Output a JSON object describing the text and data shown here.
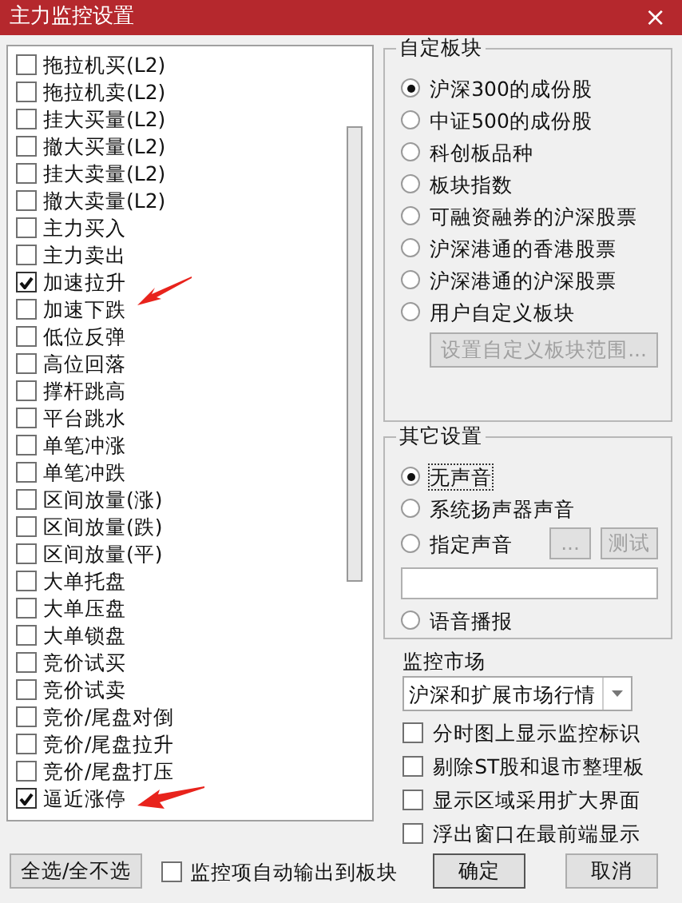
{
  "window": {
    "title": "主力监控设置",
    "close": "×"
  },
  "monitor_items": [
    {
      "label": "拖拉机买(L2)",
      "checked": false
    },
    {
      "label": "拖拉机卖(L2)",
      "checked": false
    },
    {
      "label": "挂大买量(L2)",
      "checked": false
    },
    {
      "label": "撤大买量(L2)",
      "checked": false
    },
    {
      "label": "挂大卖量(L2)",
      "checked": false
    },
    {
      "label": "撤大卖量(L2)",
      "checked": false
    },
    {
      "label": "主力买入",
      "checked": false
    },
    {
      "label": "主力卖出",
      "checked": false
    },
    {
      "label": "加速拉升",
      "checked": true
    },
    {
      "label": "加速下跌",
      "checked": false
    },
    {
      "label": "低位反弹",
      "checked": false
    },
    {
      "label": "高位回落",
      "checked": false
    },
    {
      "label": "撑杆跳高",
      "checked": false
    },
    {
      "label": "平台跳水",
      "checked": false
    },
    {
      "label": "单笔冲涨",
      "checked": false
    },
    {
      "label": "单笔冲跌",
      "checked": false
    },
    {
      "label": "区间放量(涨)",
      "checked": false
    },
    {
      "label": "区间放量(跌)",
      "checked": false
    },
    {
      "label": "区间放量(平)",
      "checked": false
    },
    {
      "label": "大单托盘",
      "checked": false
    },
    {
      "label": "大单压盘",
      "checked": false
    },
    {
      "label": "大单锁盘",
      "checked": false
    },
    {
      "label": "竞价试买",
      "checked": false
    },
    {
      "label": "竞价试卖",
      "checked": false
    },
    {
      "label": "竞价/尾盘对倒",
      "checked": false
    },
    {
      "label": "竞价/尾盘拉升",
      "checked": false
    },
    {
      "label": "竞价/尾盘打压",
      "checked": false
    },
    {
      "label": "逼近涨停",
      "checked": true
    }
  ],
  "custom_sector": {
    "title": "自定板块",
    "options": [
      {
        "label": "沪深300的成份股",
        "selected": true
      },
      {
        "label": "中证500的成份股",
        "selected": false
      },
      {
        "label": "科创板品种",
        "selected": false
      },
      {
        "label": "板块指数",
        "selected": false
      },
      {
        "label": "可融资融券的沪深股票",
        "selected": false
      },
      {
        "label": "沪深港通的香港股票",
        "selected": false
      },
      {
        "label": "沪深港通的沪深股票",
        "selected": false
      },
      {
        "label": "用户自定义板块",
        "selected": false
      }
    ],
    "range_button": {
      "label": "设置自定义板块范围...",
      "disabled": true
    }
  },
  "other_settings": {
    "title": "其它设置",
    "sound_options": [
      {
        "label": "无声音",
        "selected": true,
        "kind": "plain"
      },
      {
        "label": "系统扬声器声音",
        "selected": false,
        "kind": "plain"
      },
      {
        "label": "指定声音",
        "selected": false,
        "kind": "file",
        "browse": "...",
        "test": "测试"
      },
      {
        "label": "语音播报",
        "selected": false,
        "kind": "plain"
      }
    ]
  },
  "market": {
    "label": "监控市场",
    "value": "沪深和扩展市场行情"
  },
  "options": [
    {
      "label": "分时图上显示监控标识",
      "checked": false
    },
    {
      "label": "剔除ST股和退市整理板",
      "checked": false
    },
    {
      "label": "显示区域采用扩大界面",
      "checked": false
    },
    {
      "label": "浮出窗口在最前端显示",
      "checked": false
    }
  ],
  "footer": {
    "select_all": "全选/全不选",
    "auto_output": {
      "label": "监控项自动输出到板块",
      "checked": false
    },
    "ok": "确定",
    "cancel": "取消"
  }
}
